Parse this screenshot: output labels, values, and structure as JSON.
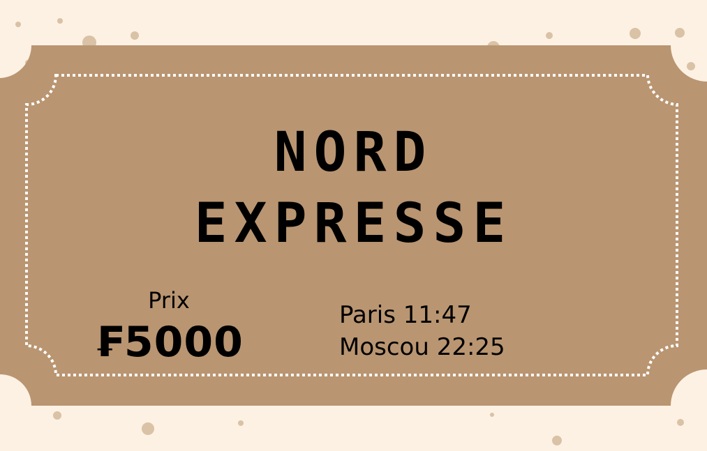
{
  "ticket": {
    "title_line1": "NORD",
    "title_line2": "EXPRESSE",
    "price_label": "Prix",
    "price_value": "₣5000",
    "departure": "Paris 11:47",
    "arrival": "Moscou 22:25"
  },
  "colors": {
    "background": "#fdf1e3",
    "ticket": "#b99571",
    "border": "#ffffff",
    "text": "#000000",
    "dots": "#d9c2a6"
  }
}
